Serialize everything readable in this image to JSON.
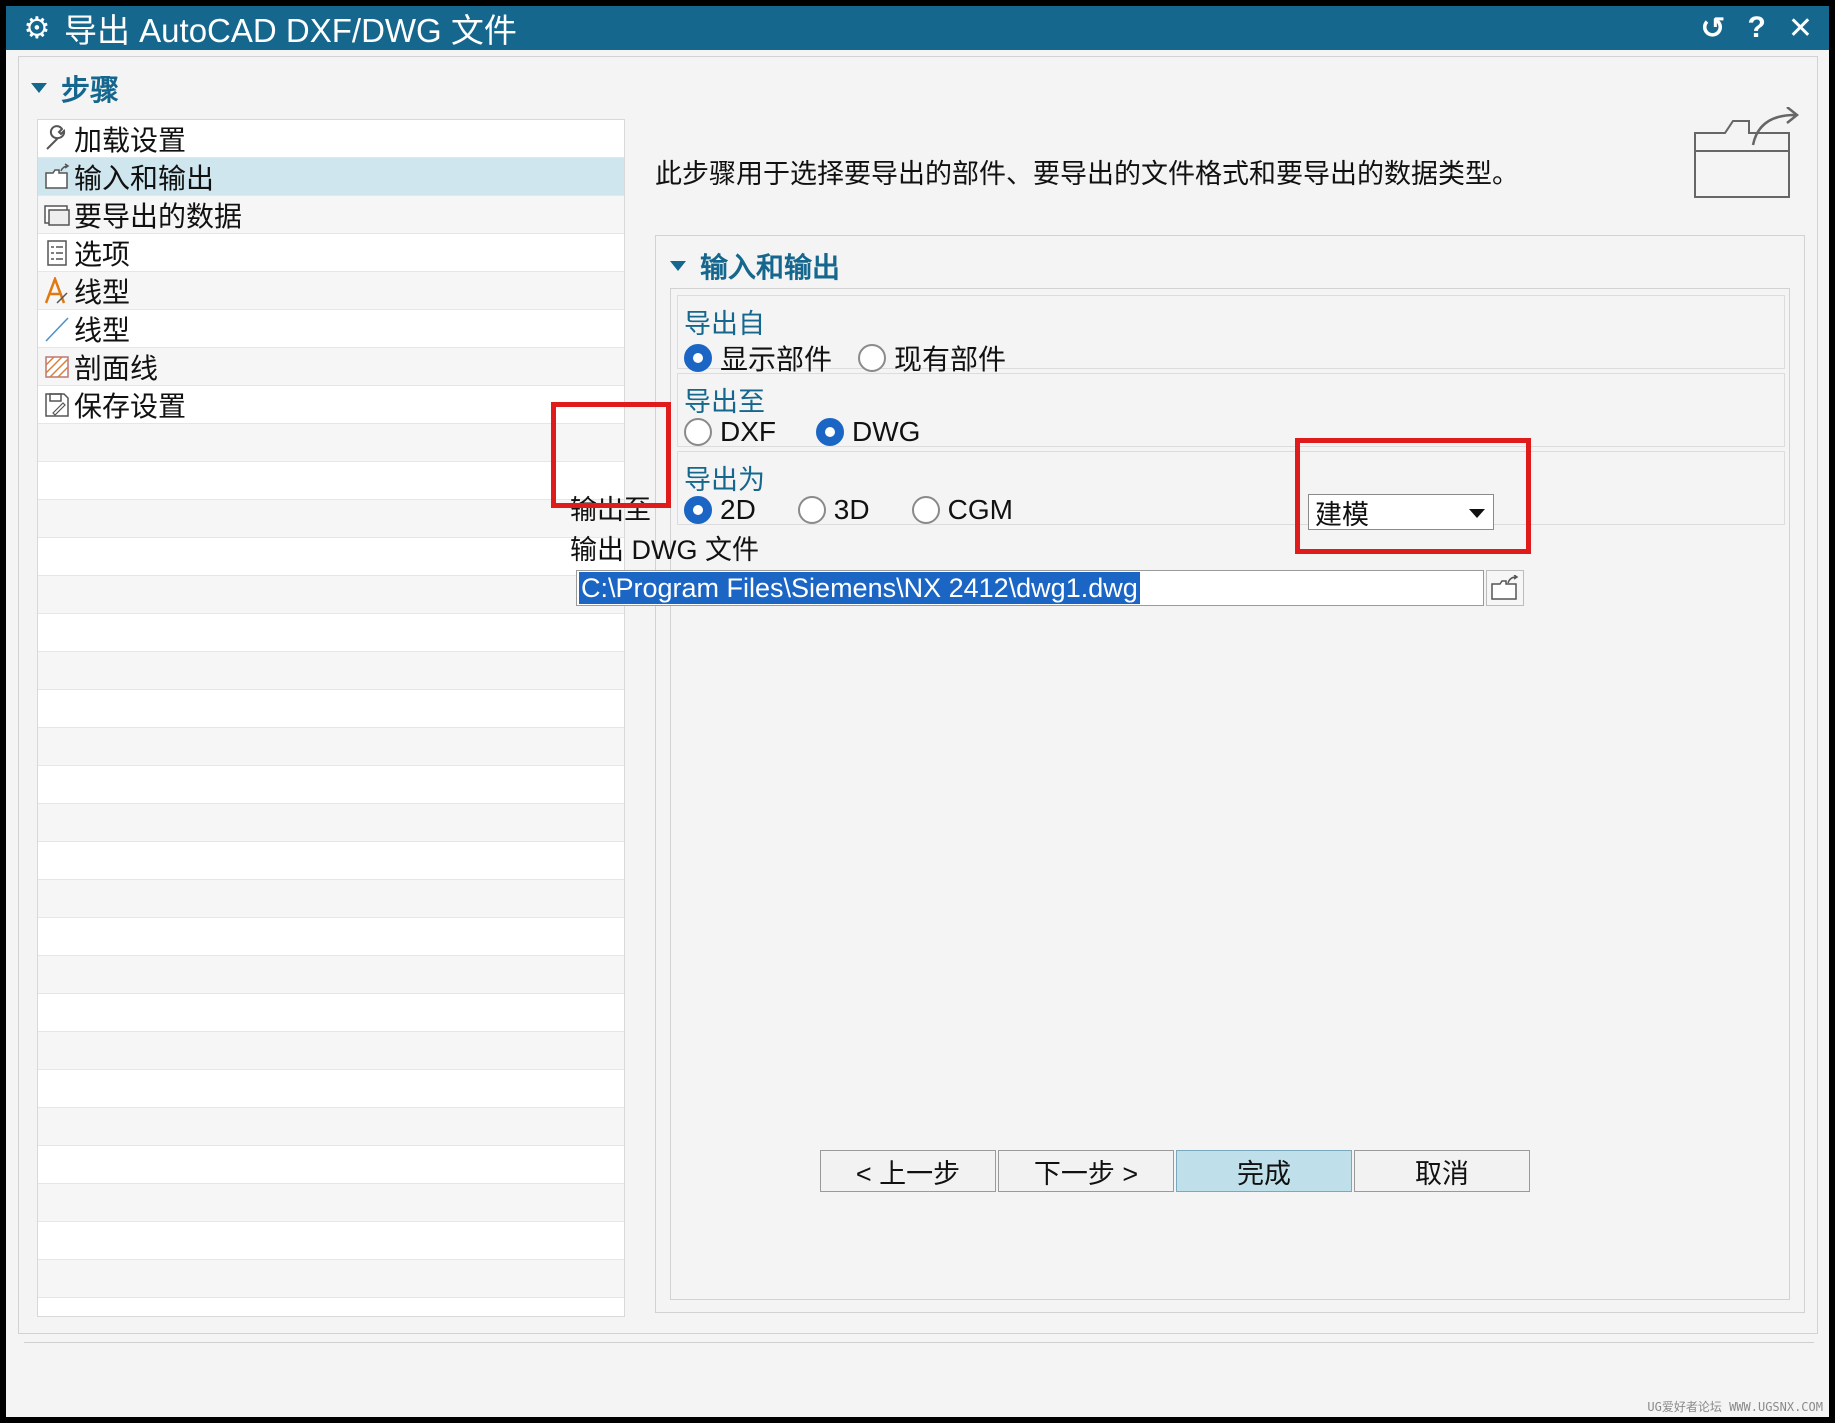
{
  "window": {
    "title": "导出 AutoCAD DXF/DWG 文件",
    "icon": "gear-icon",
    "controls": [
      "reset-icon",
      "help-icon",
      "close-icon"
    ],
    "reset_glyph": "↺",
    "help_glyph": "?",
    "close_glyph": "✕"
  },
  "steps": {
    "header": "步骤",
    "items": [
      {
        "label": "加载设置",
        "icon": "wrench-icon"
      },
      {
        "label": "输入和输出",
        "icon": "folder-export-icon",
        "selected": true
      },
      {
        "label": "要导出的数据",
        "icon": "data-window-icon"
      },
      {
        "label": "选项",
        "icon": "checklist-icon"
      },
      {
        "label": "线型",
        "icon": "font-a-icon"
      },
      {
        "label": "线型",
        "icon": "line-icon"
      },
      {
        "label": "剖面线",
        "icon": "hatch-icon"
      },
      {
        "label": "保存设置",
        "icon": "save-icon"
      }
    ]
  },
  "description": "此步骤用于选择要导出的部件、要导出的文件格式和要导出的数据类型。",
  "group": {
    "title": "输入和输出",
    "export_from": {
      "title": "导出自",
      "options": [
        "显示部件",
        "现有部件"
      ],
      "selected": "显示部件"
    },
    "export_to": {
      "title": "导出至",
      "options": [
        "DXF",
        "DWG"
      ],
      "selected": "DWG"
    },
    "export_as": {
      "title": "导出为",
      "options": [
        "2D",
        "3D",
        "CGM"
      ],
      "selected": "2D"
    },
    "output_to": {
      "label": "输出至",
      "value": "建模"
    },
    "output_file": {
      "label": "输出 DWG 文件",
      "value": "C:\\Program Files\\Siemens\\NX 2412\\dwg1.dwg"
    }
  },
  "buttons": {
    "back": "< 上一步",
    "next": "下一步 >",
    "finish": "完成",
    "cancel": "取消"
  },
  "watermark": "UG爱好者论坛 WWW.UGSNX.COM",
  "colors": {
    "accent": "#15678e",
    "radio_selected": "#1b66c4",
    "selection": "#cfe6ee",
    "highlight": "#e01b1b"
  }
}
